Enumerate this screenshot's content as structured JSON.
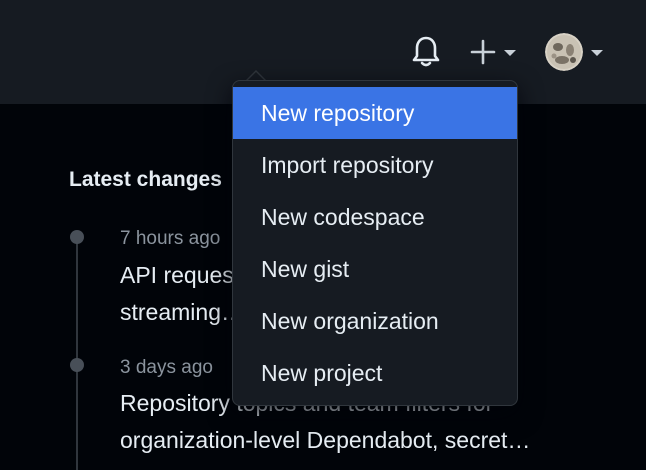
{
  "header": {
    "bell_icon": "bell-icon",
    "create_icon": "plus-icon",
    "create_caret_icon": "caret-down-icon",
    "avatar_caret_icon": "caret-down-icon"
  },
  "dashboard": {
    "latest_changes_title": "Latest changes",
    "entries": [
      {
        "time": "7 hours ago",
        "title_lines": [
          "API reques… …og",
          "streaming…"
        ]
      },
      {
        "time": "3 days ago",
        "title_lines": [
          "Repository topics and team filters for",
          "organization-level Dependabot, secret…"
        ]
      }
    ]
  },
  "create_menu": {
    "items": [
      {
        "label": "New repository",
        "active": true
      },
      {
        "label": "Import repository",
        "active": false
      },
      {
        "label": "New codespace",
        "active": false
      },
      {
        "label": "New gist",
        "active": false
      },
      {
        "label": "New organization",
        "active": false
      },
      {
        "label": "New project",
        "active": false
      }
    ]
  },
  "colors": {
    "header_bg": "#161b22",
    "page_bg": "#010409",
    "menu_bg": "#161b22",
    "menu_active_bg": "#3a74e5",
    "text": "#e6edf3",
    "muted_text": "#8b949e"
  }
}
